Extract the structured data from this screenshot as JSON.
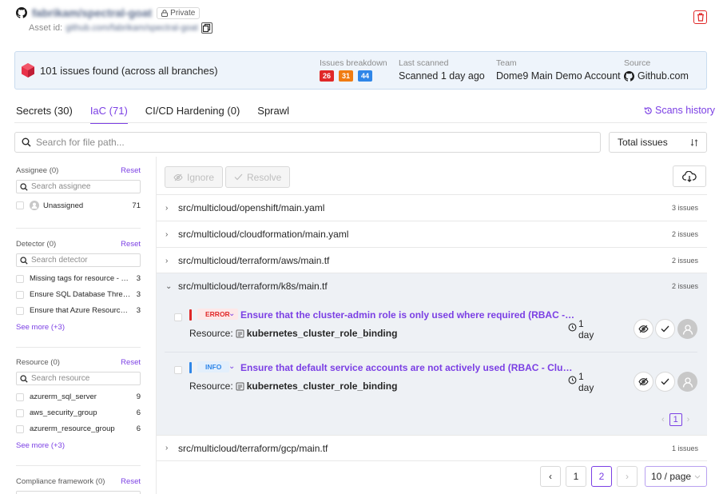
{
  "header": {
    "repo_name": "fabrikam/spectral-goat",
    "private_label": "Private",
    "asset_prefix": "Asset id:",
    "asset_id": "github.com/fabrikam/spectral-goat"
  },
  "summary": {
    "issues_text": "101 issues found (across all branches)",
    "breakdown_label": "Issues breakdown",
    "breakdown": [
      {
        "value": "26",
        "color": "#e02828"
      },
      {
        "value": "31",
        "color": "#f07c12"
      },
      {
        "value": "44",
        "color": "#2f86e8"
      }
    ],
    "last_scanned_label": "Last scanned",
    "last_scanned_value": "Scanned 1 day ago",
    "team_label": "Team",
    "team_value": "Dome9 Main Demo Account",
    "source_label": "Source",
    "source_value": "Github.com"
  },
  "tabs": [
    {
      "label": "Secrets (30)"
    },
    {
      "label": "IaC (71)"
    },
    {
      "label": "CI/CD Hardening (0)"
    },
    {
      "label": "Sprawl"
    }
  ],
  "scans_history_label": "Scans history",
  "search": {
    "placeholder": "Search for file path..."
  },
  "sort": {
    "label": "Total issues"
  },
  "sidebar": {
    "assignee": {
      "title": "Assignee (0)",
      "reset": "Reset",
      "placeholder": "Search assignee",
      "items": [
        {
          "label": "Unassigned",
          "count": "71"
        }
      ]
    },
    "detector": {
      "title": "Detector (0)",
      "reset": "Reset",
      "placeholder": "Search detector",
      "items": [
        {
          "label": "Missing tags for resource - TFA...",
          "count": "3"
        },
        {
          "label": "Ensure SQL Database Threat D...",
          "count": "3"
        },
        {
          "label": "Ensure that Azure Resource Gr...",
          "count": "3"
        }
      ],
      "see_more": "See more (+3)"
    },
    "resource": {
      "title": "Resource (0)",
      "reset": "Reset",
      "placeholder": "Search resource",
      "items": [
        {
          "label": "azurerm_sql_server",
          "count": "9"
        },
        {
          "label": "aws_security_group",
          "count": "6"
        },
        {
          "label": "azurerm_resource_group",
          "count": "6"
        }
      ],
      "see_more": "See more (+3)"
    },
    "compliance": {
      "title": "Compliance framework (0)",
      "reset": "Reset"
    }
  },
  "actions": {
    "ignore_label": "Ignore",
    "resolve_label": "Resolve"
  },
  "files": [
    {
      "path": "src/multicloud/openshift/main.yaml",
      "count": "3 issues"
    },
    {
      "path": "src/multicloud/cloudformation/main.yaml",
      "count": "2 issues"
    },
    {
      "path": "src/multicloud/terraform/aws/main.tf",
      "count": "2 issues"
    },
    {
      "path": "src/multicloud/terraform/k8s/main.tf",
      "count": "2 issues"
    },
    {
      "path": "src/multicloud/terraform/gcp/main.tf",
      "count": "1 issues"
    }
  ],
  "issues": [
    {
      "severity": "ERROR",
      "severity_color": "#e02828",
      "severity_bg": "#fde8e8",
      "title": "Ensure that the cluster-admin role is only used where required (RBAC - Clus...",
      "resource_label": "Resource:",
      "resource": "kubernetes_cluster_role_binding",
      "age_num": "1",
      "age_unit": "day"
    },
    {
      "severity": "INFO",
      "severity_color": "#2f86e8",
      "severity_bg": "#e3effc",
      "title": "Ensure that default service accounts are not actively used (RBAC - Cluster...",
      "resource_label": "Resource:",
      "resource": "kubernetes_cluster_role_binding",
      "age_num": "1",
      "age_unit": "day"
    }
  ],
  "inner_pager": {
    "current": "1"
  },
  "pagination": {
    "pages": [
      "1",
      "2"
    ],
    "current": "2",
    "page_size": "10 / page"
  }
}
